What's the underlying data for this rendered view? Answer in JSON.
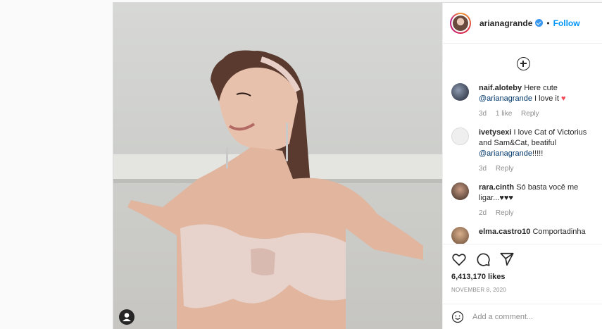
{
  "header": {
    "username": "arianagrande",
    "separator": "•",
    "follow_label": "Follow"
  },
  "comments": [
    {
      "user": "naif.aloteby",
      "text_pre": "Here cute ",
      "mention": "@arianagrande",
      "text_post": " I love it ",
      "emoji": "♥",
      "age": "3d",
      "likes": "1 like",
      "reply": "Reply"
    },
    {
      "user": "ivetysexi",
      "text_pre": "I love Cat of Victorius and Sam&Cat, beatiful ",
      "mention": "@arianagrande",
      "text_post": "!!!!!",
      "age": "3d",
      "reply": "Reply"
    },
    {
      "user": "rara.cinth",
      "text_pre": "Só basta você me ligar...♥♥♥",
      "age": "2d",
      "reply": "Reply"
    },
    {
      "user": "elma.castro10",
      "text_pre": "Comportadinha"
    }
  ],
  "likes": "6,413,170 likes",
  "date": "NOVEMBER 8, 2020",
  "add_comment_placeholder": "Add a comment...",
  "colors": {
    "link": "#0095f6",
    "mention": "#00376b",
    "heart": "#ed4956",
    "muted": "#8e8e8e"
  }
}
